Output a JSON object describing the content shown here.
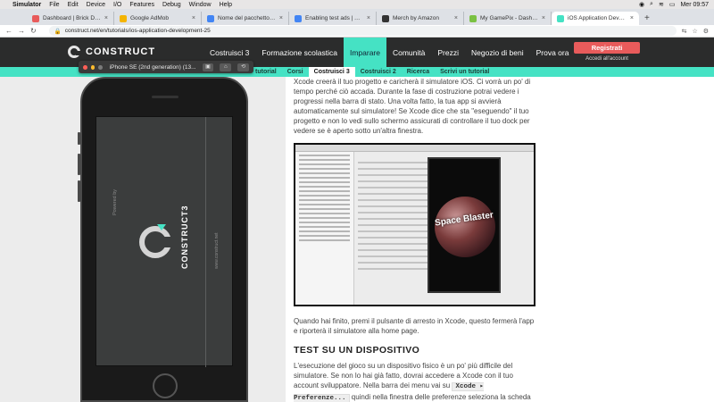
{
  "menubar": {
    "apple": "",
    "items": [
      "Simulator",
      "File",
      "Edit",
      "Device",
      "I/O",
      "Features",
      "Debug",
      "Window",
      "Help"
    ],
    "clock": "Mer 09:57",
    "status_icons": [
      "screen-record",
      "search",
      "wifi",
      "battery"
    ]
  },
  "tabs": [
    {
      "title": "Dashboard | Brick Dance",
      "color": "#e85b5b"
    },
    {
      "title": "Google AdMob",
      "color": "#f4b400"
    },
    {
      "title": "Nome del pacchetto - Guida di",
      "color": "#4285f4"
    },
    {
      "title": "Enabling test ads | Android",
      "color": "#4285f4"
    },
    {
      "title": "Merch by Amazon",
      "color": "#333333"
    },
    {
      "title": "My GamePix - Dashboard",
      "color": "#7ac142"
    },
    {
      "title": "iOS Application Development",
      "color": "#45e2c4"
    }
  ],
  "address": {
    "url": "construct.net/en/tutorials/ios-application-development-25"
  },
  "site": {
    "logo": "CONSTRUCT",
    "nav": [
      "Costruisci 3",
      "Formazione scolastica",
      "Imparare",
      "Comunità",
      "Prezzi",
      "Negozio di beni",
      "Prova ora"
    ],
    "nav_active_index": 2,
    "register": "Registrati",
    "login": "Accedi all'account",
    "subnav": [
      "tutorial",
      "Corsi",
      "Costruisci 3",
      "Costruisci 2",
      "Ricerca",
      "Scrivi un tutorial"
    ],
    "subnav_active_index": 2
  },
  "simulator": {
    "title": "iPhone SE (2nd generation) (13..."
  },
  "phone": {
    "powered": "Powered by",
    "brand": "CONSTRUCT3",
    "site": "www.construct.net"
  },
  "article": {
    "p1": "Xcode creerà il tuo progetto e caricherà il simulatore iOS. Ci vorrà un po' di tempo perché ciò accada. Durante la fase di costruzione potrai vedere i progressi nella barra di stato. Una volta fatto, la tua app si avvierà automaticamente sul simulatore! Se Xcode dice che sta \"eseguendo\" il tuo progetto e non lo vedi sullo schermo assicurati di controllare il tuo dock per vedere se è aperto sotto un'altra finestra.",
    "game_title": "Space Blaster",
    "p2": "Quando hai finito, premi il pulsante di arresto in Xcode, questo fermerà l'app e riporterà il simulatore alla home page.",
    "h2": "TEST SU UN DISPOSITIVO",
    "p3a": "L'esecuzione del gioco su un dispositivo fisico è un po' più difficile del simulatore. Se non lo hai già fatto, dovrai accedere a Xcode con il tuo account sviluppatore. Nella barra dei menu vai su ",
    "code": "Xcode ▸ Preferenze...",
    "p3b": " quindi nella finestra delle preferenze seleziona la scheda account e accedi con il tuo ID Apple."
  }
}
